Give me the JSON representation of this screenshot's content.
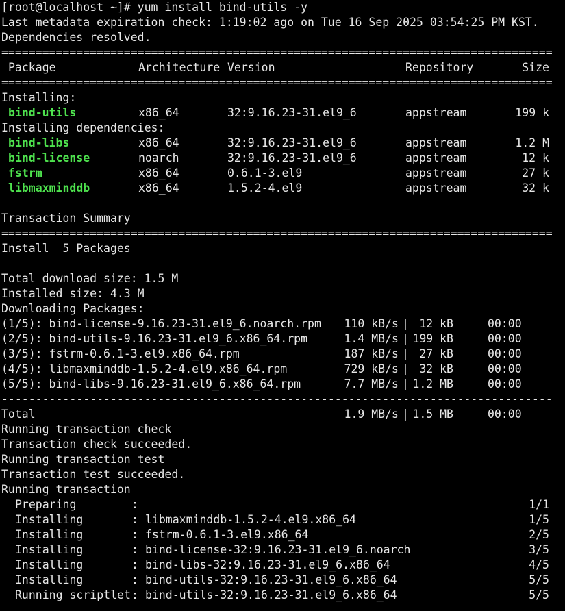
{
  "prompt": "[root@localhost ~]# yum install bind-utils -y",
  "metadata_line": "Last metadata expiration check: 1:19:02 ago on Tue 16 Sep 2025 03:54:25 PM KST.",
  "deps_resolved": "Dependencies resolved.",
  "separator_double": "=================================================================================",
  "separator_single": "---------------------------------------------------------------------------------",
  "table_header": {
    "package": "Package",
    "architecture": "Architecture",
    "version": "Version",
    "repository": "Repository",
    "size": "Size"
  },
  "installing_label": "Installing:",
  "installing": [
    {
      "name": "bind-utils",
      "arch": "x86_64",
      "version": "32:9.16.23-31.el9_6",
      "repo": "appstream",
      "size": "199 k"
    }
  ],
  "deps_label": "Installing dependencies:",
  "dependencies": [
    {
      "name": "bind-libs",
      "arch": "x86_64",
      "version": "32:9.16.23-31.el9_6",
      "repo": "appstream",
      "size": "1.2 M"
    },
    {
      "name": "bind-license",
      "arch": "noarch",
      "version": "32:9.16.23-31.el9_6",
      "repo": "appstream",
      "size": "12 k"
    },
    {
      "name": "fstrm",
      "arch": "x86_64",
      "version": "0.6.1-3.el9",
      "repo": "appstream",
      "size": "27 k"
    },
    {
      "name": "libmaxminddb",
      "arch": "x86_64",
      "version": "1.5.2-4.el9",
      "repo": "appstream",
      "size": "32 k"
    }
  ],
  "transaction_summary": "Transaction Summary",
  "install_count": "Install  5 Packages",
  "total_download": "Total download size: 1.5 M",
  "installed_size": "Installed size: 4.3 M",
  "downloading_label": "Downloading Packages:",
  "downloads": [
    {
      "file": "(1/5): bind-license-9.16.23-31.el9_6.noarch.rpm",
      "speed": "110 kB/s",
      "size": " 12 kB",
      "time": "00:00"
    },
    {
      "file": "(2/5): bind-utils-9.16.23-31.el9_6.x86_64.rpm",
      "speed": "1.4 MB/s",
      "size": "199 kB",
      "time": "00:00"
    },
    {
      "file": "(3/5): fstrm-0.6.1-3.el9.x86_64.rpm",
      "speed": "187 kB/s",
      "size": " 27 kB",
      "time": "00:00"
    },
    {
      "file": "(4/5): libmaxminddb-1.5.2-4.el9.x86_64.rpm",
      "speed": "729 kB/s",
      "size": " 32 kB",
      "time": "00:00"
    },
    {
      "file": "(5/5): bind-libs-9.16.23-31.el9_6.x86_64.rpm",
      "speed": "7.7 MB/s",
      "size": "1.2 MB",
      "time": "00:00"
    }
  ],
  "total": {
    "label": "Total",
    "speed": "1.9 MB/s",
    "size": "1.5 MB",
    "time": "00:00"
  },
  "status_lines": [
    "Running transaction check",
    "Transaction check succeeded.",
    "Running transaction test",
    "Transaction test succeeded.",
    "Running transaction"
  ],
  "steps": [
    {
      "action": "Preparing",
      "target": "",
      "progress": "1/1"
    },
    {
      "action": "Installing",
      "target": "libmaxminddb-1.5.2-4.el9.x86_64",
      "progress": "1/5"
    },
    {
      "action": "Installing",
      "target": "fstrm-0.6.1-3.el9.x86_64",
      "progress": "2/5"
    },
    {
      "action": "Installing",
      "target": "bind-license-32:9.16.23-31.el9_6.noarch",
      "progress": "3/5"
    },
    {
      "action": "Installing",
      "target": "bind-libs-32:9.16.23-31.el9_6.x86_64",
      "progress": "4/5"
    },
    {
      "action": "Installing",
      "target": "bind-utils-32:9.16.23-31.el9_6.x86_64",
      "progress": "5/5"
    },
    {
      "action": "Running scriptlet",
      "target": "bind-utils-32:9.16.23-31.el9_6.x86_64",
      "progress": "5/5"
    }
  ],
  "colors": {
    "background": "#000000",
    "text": "#e6e6e6",
    "package_highlight": "#4ee24e"
  }
}
